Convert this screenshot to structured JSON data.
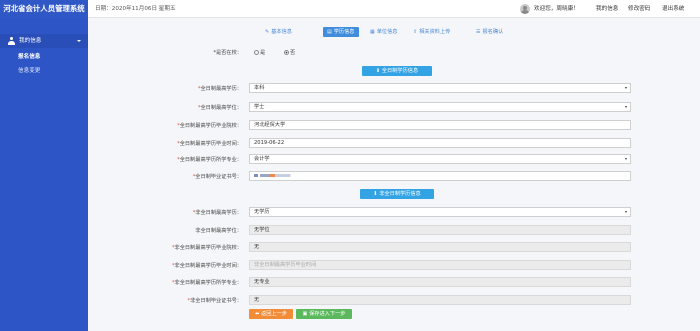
{
  "app": {
    "title": "河北省会计人员管理系统"
  },
  "header": {
    "date": "日期：2020年11月06日 星期五",
    "welcome": "欢迎您，周晓康！",
    "links": [
      "我的信息",
      "修改密码",
      "退出系统"
    ]
  },
  "sidebar": {
    "group": "我的信息",
    "items": [
      "报名信息",
      "信息变更"
    ]
  },
  "steps": [
    {
      "icon": "✎",
      "label": "基本信息"
    },
    {
      "icon": "▤",
      "label": "学历信息"
    },
    {
      "icon": "▦",
      "label": "单位信息"
    },
    {
      "icon": "⇪",
      "label": "相关资料上传"
    },
    {
      "icon": "☰",
      "label": "报名确认"
    }
  ],
  "form": {
    "in_school_label": "*是否在校：",
    "in_school_options": [
      "是",
      "否"
    ],
    "in_school_selected": "否",
    "fulltime_section_button": "全日制学历信息",
    "fulltime": [
      {
        "label": "全日制最高学历：",
        "value": "本科"
      },
      {
        "label": "全日制最高学位：",
        "value": "学士"
      },
      {
        "label": "全日制最高学历毕业院校：",
        "value": "河北经贸大学"
      },
      {
        "label": "全日制最高学历毕业时间：",
        "value": "2019-06-22"
      },
      {
        "label": "全日制最高学历所学专业：",
        "value": "会计学"
      },
      {
        "label": "全日制毕业证书号：",
        "value": ""
      }
    ],
    "nonfulltime_section_button": "非全日制学历信息",
    "nonfulltime": [
      {
        "label": "非全日制最高学历：",
        "value": "无学历"
      },
      {
        "label": "非全日制最高学位：",
        "value": "无学位"
      },
      {
        "label": "非全日制最高学历毕业院校：",
        "value": "无"
      },
      {
        "label": "非全日制最高学历毕业时间：",
        "value": "非全日制最高学历毕业时间"
      },
      {
        "label": "非全日制最高学历所学专业：",
        "value": "无专业"
      },
      {
        "label": "非全日制毕业证书号：",
        "value": "无"
      }
    ]
  },
  "actions": {
    "back": "返回上一步",
    "save_next": "保存进入下一步"
  },
  "colors": {
    "primary": "#2e55c6",
    "step_active": "#3f8ddb",
    "section_button": "#34a3e3",
    "back_button": "#f28c38",
    "save_button": "#5cb85c",
    "required": "#e24a3b"
  }
}
